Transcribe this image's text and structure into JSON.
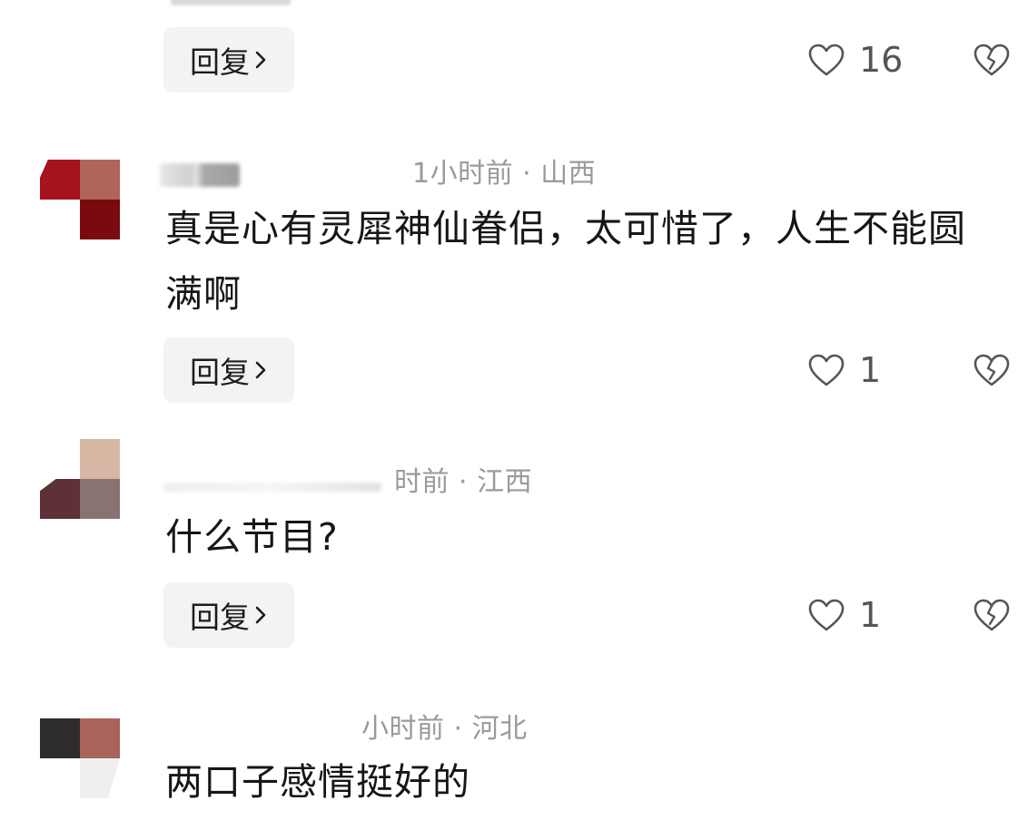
{
  "top_reply": {
    "reply_label": "回复",
    "likes": "16"
  },
  "comments": [
    {
      "meta": "1小时前 · 山西",
      "text": "真是心有灵犀神仙眷侣，太可惜了，人生不能圆满啊",
      "reply_label": "回复",
      "likes": "1"
    },
    {
      "meta": "时前 · 江西",
      "text": "什么节目?",
      "reply_label": "回复",
      "likes": "1"
    },
    {
      "meta": "小时前 · 河北",
      "text": "两口子感情挺好的"
    }
  ],
  "icons": {
    "like": "heart-outline-icon",
    "dislike": "broken-heart-icon",
    "reply_arrow": "chevron-right-icon"
  },
  "colors": {
    "meta_text": "#9a9a9a",
    "body_text": "#161616",
    "reply_bg": "#f3f3f3",
    "icon_stroke": "#555555"
  }
}
